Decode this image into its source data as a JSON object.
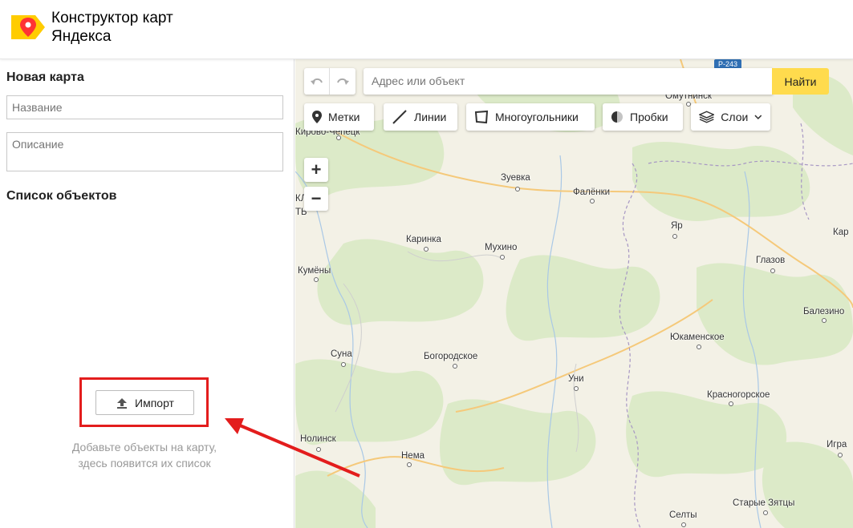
{
  "header": {
    "title_line1": "Конструктор карт",
    "title_line2": "Яндекса"
  },
  "sidebar": {
    "heading": "Новая карта",
    "name_placeholder": "Название",
    "description_placeholder": "Описание",
    "objects_heading": "Список объектов",
    "import_label": "Импорт",
    "empty_hint_line1": "Добавьте объекты на карту,",
    "empty_hint_line2": "здесь появится их список"
  },
  "map": {
    "search_placeholder": "Адрес или объект",
    "search_button": "Найти",
    "tools": {
      "markers": "Метки",
      "lines": "Линии",
      "polygons": "Многоугольники",
      "traffic": "Пробки",
      "layers": "Слои"
    },
    "zoom_in": "+",
    "zoom_out": "−",
    "road_badge": "Р-243",
    "cities": {
      "kirovo_chepetsk": "Кирово-Чепецк",
      "omutninsk": "Омутнинск",
      "zuevka": "Зуевка",
      "falenki": "Фалёнки",
      "yar": "Яр",
      "karinka": "Каринка",
      "mukhino": "Мухино",
      "glazov": "Глазов",
      "kar": "Кар",
      "kumeny": "Кумёны",
      "balezino": "Балезино",
      "yukamenskoe": "Юкаменское",
      "suna": "Суна",
      "bogorodskoe": "Богородское",
      "uni": "Уни",
      "krasnogorskoe": "Красногорское",
      "nolinsk": "Нолинск",
      "igra": "Игра",
      "nema": "Нема",
      "selty": "Селты",
      "starye_zyattsy": "Старые Зятцы",
      "kl": "КЛ",
      "t": "ТЬ"
    }
  },
  "colors": {
    "accent_yellow": "#ffdb4d",
    "highlight_red": "#e31d1d",
    "logo_red": "#f33",
    "logo_yellow": "#ffcc00"
  }
}
